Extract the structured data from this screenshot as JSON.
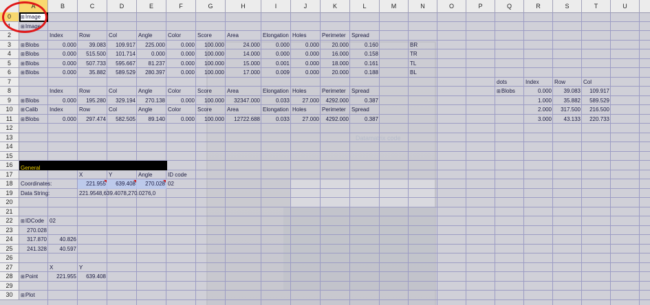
{
  "columns": [
    "A",
    "B",
    "C",
    "D",
    "E",
    "F",
    "G",
    "H",
    "I",
    "J",
    "K",
    "L",
    "M",
    "N",
    "O",
    "P",
    "Q",
    "R",
    "S",
    "T",
    "U"
  ],
  "rows": [
    "0",
    "1",
    "2",
    "3",
    "4",
    "5",
    "6",
    "7",
    "8",
    "9",
    "10",
    "11",
    "12",
    "13",
    "14",
    "15",
    "16",
    "17",
    "18",
    "19",
    "20",
    "21",
    "22",
    "23",
    "24",
    "25",
    "26",
    "27",
    "28",
    "29",
    "30"
  ],
  "cells": [
    {
      "r": 0,
      "c": 0,
      "t": "Image",
      "icon": true
    },
    {
      "r": 1,
      "c": 0,
      "t": "Image",
      "icon": true
    },
    {
      "r": 2,
      "c": 1,
      "t": "Index"
    },
    {
      "r": 2,
      "c": 2,
      "t": "Row"
    },
    {
      "r": 2,
      "c": 3,
      "t": "Col"
    },
    {
      "r": 2,
      "c": 4,
      "t": "Angle"
    },
    {
      "r": 2,
      "c": 5,
      "t": "Color"
    },
    {
      "r": 2,
      "c": 6,
      "t": "Score"
    },
    {
      "r": 2,
      "c": 7,
      "t": "Area"
    },
    {
      "r": 2,
      "c": 8,
      "t": "Elongation"
    },
    {
      "r": 2,
      "c": 9,
      "t": "Holes"
    },
    {
      "r": 2,
      "c": 10,
      "t": "Perimeter"
    },
    {
      "r": 2,
      "c": 11,
      "t": "Spread"
    },
    {
      "r": 3,
      "c": 0,
      "t": "Blobs",
      "icon": true
    },
    {
      "r": 3,
      "c": 1,
      "t": "0.000",
      "n": true
    },
    {
      "r": 3,
      "c": 2,
      "t": "39.083",
      "n": true
    },
    {
      "r": 3,
      "c": 3,
      "t": "109.917",
      "n": true
    },
    {
      "r": 3,
      "c": 4,
      "t": "225.000",
      "n": true
    },
    {
      "r": 3,
      "c": 5,
      "t": "0.000",
      "n": true
    },
    {
      "r": 3,
      "c": 6,
      "t": "100.000",
      "n": true
    },
    {
      "r": 3,
      "c": 7,
      "t": "24.000",
      "n": true
    },
    {
      "r": 3,
      "c": 8,
      "t": "0.000",
      "n": true
    },
    {
      "r": 3,
      "c": 9,
      "t": "0.000",
      "n": true
    },
    {
      "r": 3,
      "c": 10,
      "t": "20.000",
      "n": true
    },
    {
      "r": 3,
      "c": 11,
      "t": "0.160",
      "n": true
    },
    {
      "r": 3,
      "c": 13,
      "t": "BR"
    },
    {
      "r": 4,
      "c": 0,
      "t": "Blobs",
      "icon": true
    },
    {
      "r": 4,
      "c": 1,
      "t": "0.000",
      "n": true
    },
    {
      "r": 4,
      "c": 2,
      "t": "515.500",
      "n": true
    },
    {
      "r": 4,
      "c": 3,
      "t": "101.714",
      "n": true
    },
    {
      "r": 4,
      "c": 4,
      "t": "0.000",
      "n": true
    },
    {
      "r": 4,
      "c": 5,
      "t": "0.000",
      "n": true
    },
    {
      "r": 4,
      "c": 6,
      "t": "100.000",
      "n": true
    },
    {
      "r": 4,
      "c": 7,
      "t": "14.000",
      "n": true
    },
    {
      "r": 4,
      "c": 8,
      "t": "0.000",
      "n": true
    },
    {
      "r": 4,
      "c": 9,
      "t": "0.000",
      "n": true
    },
    {
      "r": 4,
      "c": 10,
      "t": "16.000",
      "n": true
    },
    {
      "r": 4,
      "c": 11,
      "t": "0.158",
      "n": true
    },
    {
      "r": 4,
      "c": 13,
      "t": "TR"
    },
    {
      "r": 5,
      "c": 0,
      "t": "Blobs",
      "icon": true
    },
    {
      "r": 5,
      "c": 1,
      "t": "0.000",
      "n": true
    },
    {
      "r": 5,
      "c": 2,
      "t": "507.733",
      "n": true
    },
    {
      "r": 5,
      "c": 3,
      "t": "595.667",
      "n": true
    },
    {
      "r": 5,
      "c": 4,
      "t": "81.237",
      "n": true
    },
    {
      "r": 5,
      "c": 5,
      "t": "0.000",
      "n": true
    },
    {
      "r": 5,
      "c": 6,
      "t": "100.000",
      "n": true
    },
    {
      "r": 5,
      "c": 7,
      "t": "15.000",
      "n": true
    },
    {
      "r": 5,
      "c": 8,
      "t": "0.001",
      "n": true
    },
    {
      "r": 5,
      "c": 9,
      "t": "0.000",
      "n": true
    },
    {
      "r": 5,
      "c": 10,
      "t": "18.000",
      "n": true
    },
    {
      "r": 5,
      "c": 11,
      "t": "0.161",
      "n": true
    },
    {
      "r": 5,
      "c": 13,
      "t": "TL"
    },
    {
      "r": 6,
      "c": 0,
      "t": "Blobs",
      "icon": true
    },
    {
      "r": 6,
      "c": 1,
      "t": "0.000",
      "n": true
    },
    {
      "r": 6,
      "c": 2,
      "t": "35.882",
      "n": true
    },
    {
      "r": 6,
      "c": 3,
      "t": "589.529",
      "n": true
    },
    {
      "r": 6,
      "c": 4,
      "t": "280.397",
      "n": true
    },
    {
      "r": 6,
      "c": 5,
      "t": "0.000",
      "n": true
    },
    {
      "r": 6,
      "c": 6,
      "t": "100.000",
      "n": true
    },
    {
      "r": 6,
      "c": 7,
      "t": "17.000",
      "n": true
    },
    {
      "r": 6,
      "c": 8,
      "t": "0.009",
      "n": true
    },
    {
      "r": 6,
      "c": 9,
      "t": "0.000",
      "n": true
    },
    {
      "r": 6,
      "c": 10,
      "t": "20.000",
      "n": true
    },
    {
      "r": 6,
      "c": 11,
      "t": "0.188",
      "n": true
    },
    {
      "r": 6,
      "c": 13,
      "t": "BL"
    },
    {
      "r": 7,
      "c": 16,
      "t": "dots"
    },
    {
      "r": 7,
      "c": 17,
      "t": "Index"
    },
    {
      "r": 7,
      "c": 18,
      "t": "Row"
    },
    {
      "r": 7,
      "c": 19,
      "t": "Col"
    },
    {
      "r": 8,
      "c": 1,
      "t": "Index"
    },
    {
      "r": 8,
      "c": 2,
      "t": "Row"
    },
    {
      "r": 8,
      "c": 3,
      "t": "Col"
    },
    {
      "r": 8,
      "c": 4,
      "t": "Angle"
    },
    {
      "r": 8,
      "c": 5,
      "t": "Color"
    },
    {
      "r": 8,
      "c": 6,
      "t": "Score"
    },
    {
      "r": 8,
      "c": 7,
      "t": "Area"
    },
    {
      "r": 8,
      "c": 8,
      "t": "Elongation"
    },
    {
      "r": 8,
      "c": 9,
      "t": "Holes"
    },
    {
      "r": 8,
      "c": 10,
      "t": "Perimeter"
    },
    {
      "r": 8,
      "c": 11,
      "t": "Spread"
    },
    {
      "r": 8,
      "c": 16,
      "t": "Blobs",
      "icon": true
    },
    {
      "r": 8,
      "c": 17,
      "t": "0.000",
      "n": true
    },
    {
      "r": 8,
      "c": 18,
      "t": "39.083",
      "n": true
    },
    {
      "r": 8,
      "c": 19,
      "t": "109.917",
      "n": true
    },
    {
      "r": 9,
      "c": 0,
      "t": "Blobs",
      "icon": true
    },
    {
      "r": 9,
      "c": 1,
      "t": "0.000",
      "n": true
    },
    {
      "r": 9,
      "c": 2,
      "t": "195.280",
      "n": true
    },
    {
      "r": 9,
      "c": 3,
      "t": "329.194",
      "n": true
    },
    {
      "r": 9,
      "c": 4,
      "t": "270.138",
      "n": true
    },
    {
      "r": 9,
      "c": 5,
      "t": "0.000",
      "n": true
    },
    {
      "r": 9,
      "c": 6,
      "t": "100.000",
      "n": true
    },
    {
      "r": 9,
      "c": 7,
      "t": "32347.000",
      "n": true
    },
    {
      "r": 9,
      "c": 8,
      "t": "0.033",
      "n": true
    },
    {
      "r": 9,
      "c": 9,
      "t": "27.000",
      "n": true
    },
    {
      "r": 9,
      "c": 10,
      "t": "4292.000",
      "n": true
    },
    {
      "r": 9,
      "c": 11,
      "t": "0.387",
      "n": true
    },
    {
      "r": 9,
      "c": 17,
      "t": "1.000",
      "n": true
    },
    {
      "r": 9,
      "c": 18,
      "t": "35.882",
      "n": true
    },
    {
      "r": 9,
      "c": 19,
      "t": "589.529",
      "n": true
    },
    {
      "r": 10,
      "c": 0,
      "t": "Calib",
      "icon": true
    },
    {
      "r": 10,
      "c": 1,
      "t": "Index"
    },
    {
      "r": 10,
      "c": 2,
      "t": "Row"
    },
    {
      "r": 10,
      "c": 3,
      "t": "Col"
    },
    {
      "r": 10,
      "c": 4,
      "t": "Angle"
    },
    {
      "r": 10,
      "c": 5,
      "t": "Color"
    },
    {
      "r": 10,
      "c": 6,
      "t": "Score"
    },
    {
      "r": 10,
      "c": 7,
      "t": "Area"
    },
    {
      "r": 10,
      "c": 8,
      "t": "Elongation"
    },
    {
      "r": 10,
      "c": 9,
      "t": "Holes"
    },
    {
      "r": 10,
      "c": 10,
      "t": "Perimeter"
    },
    {
      "r": 10,
      "c": 11,
      "t": "Spread"
    },
    {
      "r": 10,
      "c": 17,
      "t": "2.000",
      "n": true
    },
    {
      "r": 10,
      "c": 18,
      "t": "317.500",
      "n": true
    },
    {
      "r": 10,
      "c": 19,
      "t": "216.500",
      "n": true
    },
    {
      "r": 11,
      "c": 0,
      "t": "Blobs",
      "icon": true
    },
    {
      "r": 11,
      "c": 1,
      "t": "0.000",
      "n": true
    },
    {
      "r": 11,
      "c": 2,
      "t": "297.474",
      "n": true
    },
    {
      "r": 11,
      "c": 3,
      "t": "582.505",
      "n": true
    },
    {
      "r": 11,
      "c": 4,
      "t": "89.140",
      "n": true
    },
    {
      "r": 11,
      "c": 5,
      "t": "0.000",
      "n": true
    },
    {
      "r": 11,
      "c": 6,
      "t": "100.000",
      "n": true
    },
    {
      "r": 11,
      "c": 7,
      "t": "12722.688",
      "n": true
    },
    {
      "r": 11,
      "c": 8,
      "t": "0.033",
      "n": true
    },
    {
      "r": 11,
      "c": 9,
      "t": "27.000",
      "n": true
    },
    {
      "r": 11,
      "c": 10,
      "t": "4292.000",
      "n": true
    },
    {
      "r": 11,
      "c": 11,
      "t": "0.387",
      "n": true
    },
    {
      "r": 11,
      "c": 17,
      "t": "3.000",
      "n": true
    },
    {
      "r": 11,
      "c": 18,
      "t": "43.133",
      "n": true
    },
    {
      "r": 11,
      "c": 19,
      "t": "220.733",
      "n": true
    },
    {
      "r": 17,
      "c": 2,
      "t": "X"
    },
    {
      "r": 17,
      "c": 3,
      "t": "Y"
    },
    {
      "r": 17,
      "c": 4,
      "t": "Angle"
    },
    {
      "r": 17,
      "c": 5,
      "t": "ID code"
    },
    {
      "r": 18,
      "c": 0,
      "t": "Coordinates:"
    },
    {
      "r": 18,
      "c": 2,
      "t": "221.955",
      "n": true
    },
    {
      "r": 18,
      "c": 3,
      "t": "639.408",
      "n": true
    },
    {
      "r": 18,
      "c": 4,
      "t": "270.028",
      "n": true
    },
    {
      "r": 18,
      "c": 5,
      "t": "02"
    },
    {
      "r": 19,
      "c": 0,
      "t": "Data String:"
    },
    {
      "r": 19,
      "c": 2,
      "t": "221.9548,639.4078,270.0276,0"
    },
    {
      "r": 22,
      "c": 0,
      "t": "IDCode",
      "icon": true
    },
    {
      "r": 22,
      "c": 1,
      "t": "02"
    },
    {
      "r": 23,
      "c": 0,
      "t": "270.028",
      "n": true
    },
    {
      "r": 24,
      "c": 0,
      "t": "317.870",
      "n": true
    },
    {
      "r": 24,
      "c": 1,
      "t": "40.826",
      "n": true
    },
    {
      "r": 25,
      "c": 0,
      "t": "241.328",
      "n": true
    },
    {
      "r": 25,
      "c": 1,
      "t": "40.597",
      "n": true
    },
    {
      "r": 27,
      "c": 1,
      "t": "X"
    },
    {
      "r": 27,
      "c": 2,
      "t": "Y"
    },
    {
      "r": 28,
      "c": 0,
      "t": "Point",
      "icon": true
    },
    {
      "r": 28,
      "c": 1,
      "t": "221.955",
      "n": true
    },
    {
      "r": 28,
      "c": 2,
      "t": "639.408",
      "n": true
    },
    {
      "r": 30,
      "c": 0,
      "t": "Plot",
      "icon": true
    }
  ],
  "general_label": "General",
  "watermark_text": "Datamatrix code",
  "icon_glyph": "⊞",
  "colors": {
    "header_selected": "#f8d870",
    "annotation_circle": "#e01818",
    "general_bg": "#000000",
    "general_text": "#f0d000"
  }
}
